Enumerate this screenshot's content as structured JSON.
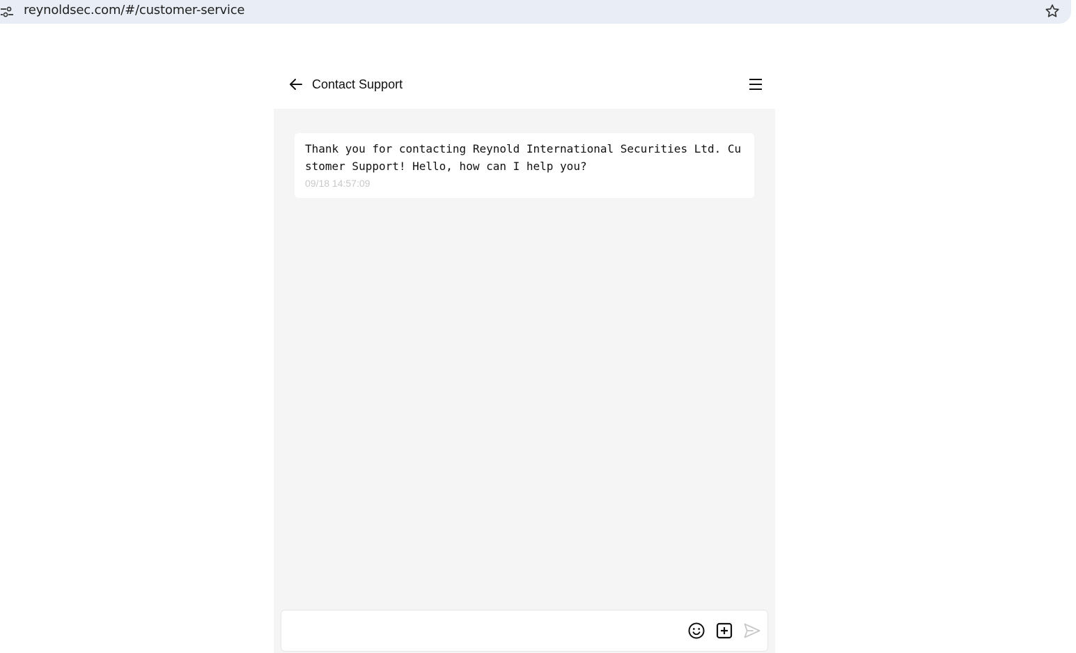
{
  "browser": {
    "url": "reynoldsec.com/#/customer-service"
  },
  "header": {
    "title": "Contact Support"
  },
  "messages": [
    {
      "text": "Thank you for contacting Reynold International Securities Ltd. Customer Support! Hello, how can I help you?",
      "time": "09/18 14:57:09"
    }
  ],
  "composer": {
    "value": "",
    "placeholder": ""
  },
  "icons": {
    "back": "arrow-left-icon",
    "menu": "hamburger-menu-icon",
    "emoji": "smiley-icon",
    "attach": "plus-square-icon",
    "send": "send-icon",
    "star": "star-icon",
    "site_info": "tune-icon"
  },
  "colors": {
    "browser_bar": "#e9eef6",
    "chat_background": "#f5f5f5",
    "timestamp": "#c8c8c8",
    "send_disabled": "#c8c8c8"
  }
}
